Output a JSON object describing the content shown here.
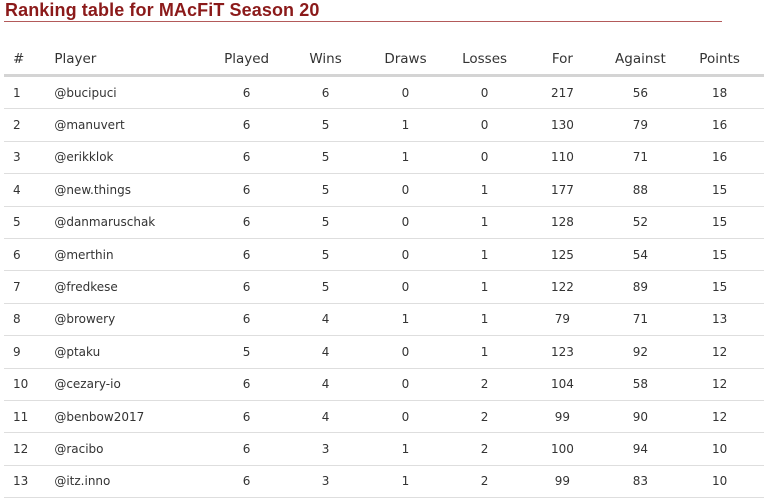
{
  "page": {
    "title": "Ranking table for MAcFiT Season 20",
    "accent_color": "#8b1a1a"
  },
  "table": {
    "headers": {
      "rank": "#",
      "player": "Player",
      "played": "Played",
      "wins": "Wins",
      "draws": "Draws",
      "losses": "Losses",
      "for": "For",
      "against": "Against",
      "points": "Points"
    },
    "rows": [
      {
        "rank": "1",
        "player": "@bucipuci",
        "played": "6",
        "wins": "6",
        "draws": "0",
        "losses": "0",
        "for": "217",
        "against": "56",
        "points": "18"
      },
      {
        "rank": "2",
        "player": "@manuvert",
        "played": "6",
        "wins": "5",
        "draws": "1",
        "losses": "0",
        "for": "130",
        "against": "79",
        "points": "16"
      },
      {
        "rank": "3",
        "player": "@erikklok",
        "played": "6",
        "wins": "5",
        "draws": "1",
        "losses": "0",
        "for": "110",
        "against": "71",
        "points": "16"
      },
      {
        "rank": "4",
        "player": "@new.things",
        "played": "6",
        "wins": "5",
        "draws": "0",
        "losses": "1",
        "for": "177",
        "against": "88",
        "points": "15"
      },
      {
        "rank": "5",
        "player": "@danmaruschak",
        "played": "6",
        "wins": "5",
        "draws": "0",
        "losses": "1",
        "for": "128",
        "against": "52",
        "points": "15"
      },
      {
        "rank": "6",
        "player": "@merthin",
        "played": "6",
        "wins": "5",
        "draws": "0",
        "losses": "1",
        "for": "125",
        "against": "54",
        "points": "15"
      },
      {
        "rank": "7",
        "player": "@fredkese",
        "played": "6",
        "wins": "5",
        "draws": "0",
        "losses": "1",
        "for": "122",
        "against": "89",
        "points": "15"
      },
      {
        "rank": "8",
        "player": "@browery",
        "played": "6",
        "wins": "4",
        "draws": "1",
        "losses": "1",
        "for": "79",
        "against": "71",
        "points": "13"
      },
      {
        "rank": "9",
        "player": "@ptaku",
        "played": "5",
        "wins": "4",
        "draws": "0",
        "losses": "1",
        "for": "123",
        "against": "92",
        "points": "12"
      },
      {
        "rank": "10",
        "player": "@cezary-io",
        "played": "6",
        "wins": "4",
        "draws": "0",
        "losses": "2",
        "for": "104",
        "against": "58",
        "points": "12"
      },
      {
        "rank": "11",
        "player": "@benbow2017",
        "played": "6",
        "wins": "4",
        "draws": "0",
        "losses": "2",
        "for": "99",
        "against": "90",
        "points": "12"
      },
      {
        "rank": "12",
        "player": "@racibo",
        "played": "6",
        "wins": "3",
        "draws": "1",
        "losses": "2",
        "for": "100",
        "against": "94",
        "points": "10"
      },
      {
        "rank": "13",
        "player": "@itz.inno",
        "played": "6",
        "wins": "3",
        "draws": "1",
        "losses": "2",
        "for": "99",
        "against": "83",
        "points": "10"
      }
    ]
  }
}
